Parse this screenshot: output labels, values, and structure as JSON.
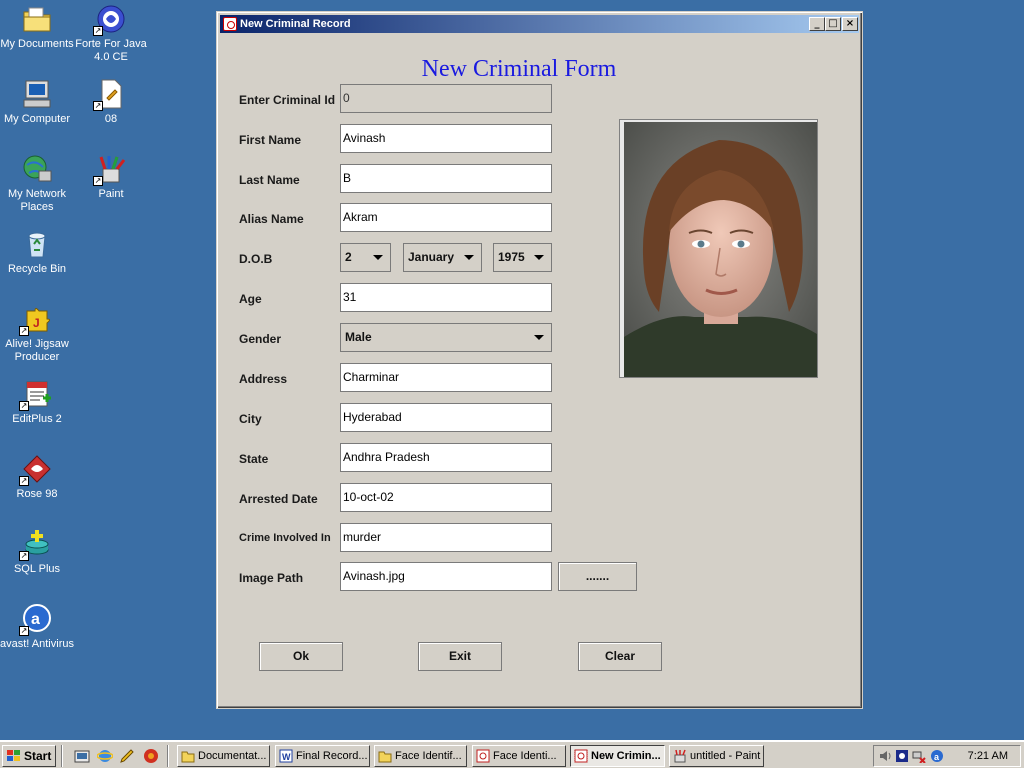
{
  "desktop": {
    "icons": [
      {
        "label": "My Documents"
      },
      {
        "label": "Forte For Java 4.0 CE"
      },
      {
        "label": "My Computer"
      },
      {
        "label": "08"
      },
      {
        "label": "My Network Places"
      },
      {
        "label": "Paint"
      },
      {
        "label": "Recycle Bin"
      },
      {
        "label": "Alive! Jigsaw Producer"
      },
      {
        "label": "EditPlus 2"
      },
      {
        "label": "Rose 98"
      },
      {
        "label": "SQL Plus"
      },
      {
        "label": "avast! Antivirus"
      }
    ]
  },
  "window": {
    "title": "New Criminal Record",
    "controls": {
      "minimize": "_",
      "maximize": "□",
      "close": "×"
    },
    "heading": "New Criminal Form",
    "fields": {
      "criminal_id": {
        "label": "Enter Criminal Id",
        "value": "0"
      },
      "first_name": {
        "label": "First Name",
        "value": "Avinash"
      },
      "last_name": {
        "label": "Last Name",
        "value": "B"
      },
      "alias_name": {
        "label": "Alias Name",
        "value": "Akram"
      },
      "dob": {
        "label": "D.O.B",
        "day": "2",
        "month": "January",
        "year": "1975"
      },
      "age": {
        "label": "Age",
        "value": "31"
      },
      "gender": {
        "label": "Gender",
        "value": "Male"
      },
      "address": {
        "label": "Address",
        "value": "Charminar"
      },
      "city": {
        "label": "City",
        "value": "Hyderabad"
      },
      "state": {
        "label": "State",
        "value": "Andhra Pradesh"
      },
      "arrested_date": {
        "label": "Arrested Date",
        "value": "10-oct-02"
      },
      "crime": {
        "label": "Crime Involved In",
        "value": "murder"
      },
      "image_path": {
        "label": "Image Path",
        "value": "Avinash.jpg",
        "browse": "......."
      }
    },
    "buttons": {
      "ok": "Ok",
      "exit": "Exit",
      "clear": "Clear"
    }
  },
  "taskbar": {
    "start": "Start",
    "tasks": [
      {
        "label": "Documentat...",
        "active": false
      },
      {
        "label": "Final Record...",
        "active": false
      },
      {
        "label": "Face Identif...",
        "active": false
      },
      {
        "label": "Face Identi...",
        "active": false
      },
      {
        "label": "New Crimin...",
        "active": true
      },
      {
        "label": "untitled - Paint",
        "active": false
      }
    ],
    "clock": "7:21 AM"
  },
  "colors": {
    "desktop": "#3a6ea5",
    "heading": "#1a1ae0",
    "titlebar_start": "#0a246a",
    "titlebar_end": "#a6caf0"
  }
}
